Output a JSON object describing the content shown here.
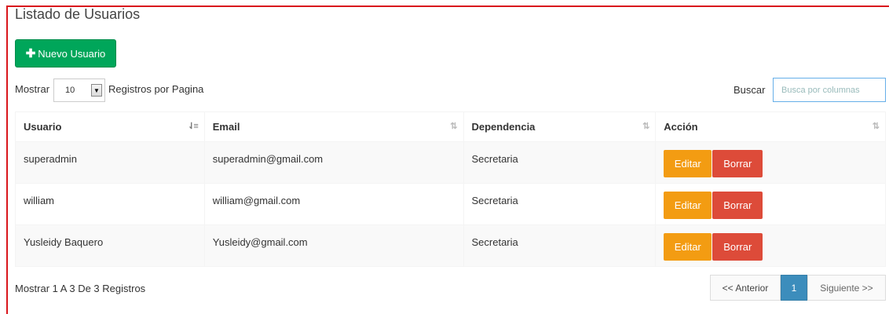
{
  "page": {
    "title": "Listado de Usuarios",
    "new_button": "Nuevo Usuario",
    "new_button_icon": "plus-icon"
  },
  "controls": {
    "show_label": "Mostrar",
    "page_size": "10",
    "per_page_label": "Registros por Pagina",
    "search_label": "Buscar",
    "search_placeholder": "Busca por columnas"
  },
  "table": {
    "headers": [
      "Usuario",
      "Email",
      "Dependencia",
      "Acción"
    ],
    "sort_icons": [
      "sort-asc-icon",
      "sort-icon",
      "sort-icon",
      "sort-icon"
    ],
    "rows": [
      {
        "usuario": "superadmin",
        "email": "superadmin@gmail.com",
        "dependencia": "Secretaria"
      },
      {
        "usuario": "william",
        "email": "william@gmail.com",
        "dependencia": "Secretaria"
      },
      {
        "usuario": "Yusleidy Baquero",
        "email": "Yusleidy@gmail.com",
        "dependencia": "Secretaria"
      }
    ],
    "edit_label": "Editar",
    "delete_label": "Borrar"
  },
  "footer": {
    "info": "Mostrar 1 A 3 De 3 Registros",
    "prev": "<< Anterior",
    "current_page": "1",
    "next": "Siguiente >>"
  },
  "colors": {
    "success": "#00a65a",
    "warning": "#f39c12",
    "danger": "#dd4b39",
    "primary": "#3c8dbc",
    "frame_border": "#d9161c"
  }
}
